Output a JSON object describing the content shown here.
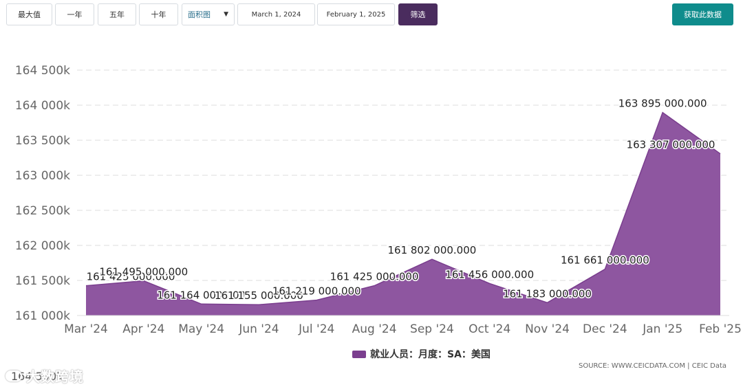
{
  "toolbar": {
    "ranges": [
      "最大值",
      "一年",
      "五年",
      "十年"
    ],
    "chart_type": "面积图",
    "start_date": "March 1, 2024",
    "end_date": "February 1, 2025",
    "filter_label": "筛选",
    "fetch_label": "获取此数据"
  },
  "colors": {
    "area_fill": "#8e56a0",
    "area_line": "#7a3e8e",
    "legend_swatch": "#7b3f8f",
    "filter_button": "#4a2c5e",
    "fetch_button": "#0f8c8c"
  },
  "chart_data": {
    "type": "area",
    "categories": [
      "Mar '24",
      "Apr '24",
      "May '24",
      "Jun '24",
      "Jul '24",
      "Aug '24",
      "Sep '24",
      "Oct '24",
      "Nov '24",
      "Dec '24",
      "Jan '25",
      "Feb '25"
    ],
    "series": [
      {
        "name": "就业人员：月度：SA：美国",
        "values": [
          161425000,
          161495000,
          161164000,
          161155000,
          161219000,
          161425000,
          161802000,
          161456000,
          161183000,
          161661000,
          163895000,
          163307000
        ],
        "labels": [
          "161 425 000.000",
          "161 495 000.000",
          "161 164 000.000",
          "161 155 000.000",
          "161 219 000.000",
          "161 425 000.000",
          "161 802 000.000",
          "161 456 000.000",
          "161 183 000.000",
          "161 661 000.000",
          "163 895 000.000",
          "163 307 000.000"
        ]
      }
    ],
    "yticks": [
      161000000,
      161500000,
      162000000,
      162500000,
      163000000,
      163500000,
      164000000,
      164500000
    ],
    "ytick_labels": [
      "161 000k",
      "161 500k",
      "162 000k",
      "162 500k",
      "163 000k",
      "163 500k",
      "164 000k",
      "164 500k"
    ],
    "ylim": [
      161000000,
      164500000
    ],
    "grid": true,
    "legend_position": "bottom-center"
  },
  "source_text": "SOURCE: WWW.CEICDATA.COM | CEIC Data",
  "watermark_text": "大数跨境",
  "ghost_tick_text": "164 500k"
}
